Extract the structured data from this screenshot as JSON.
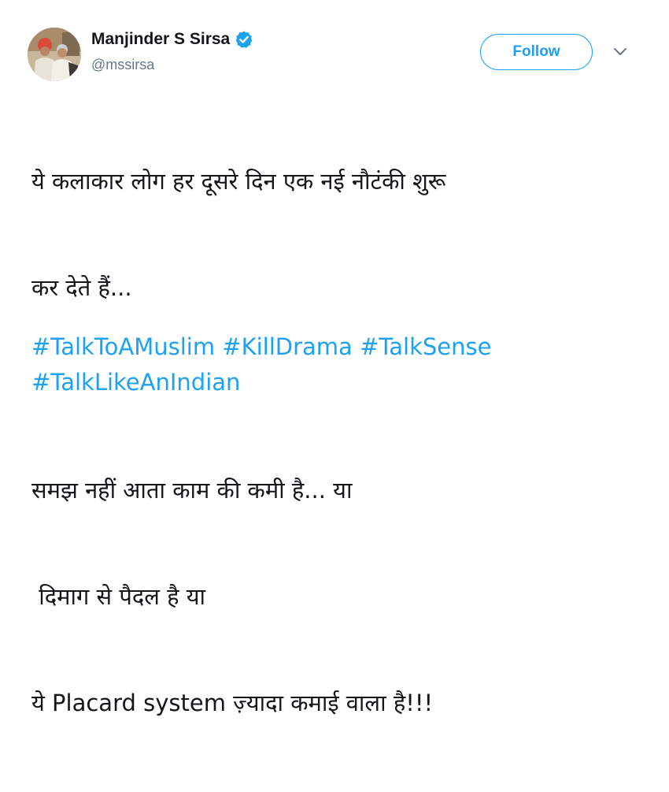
{
  "author": {
    "name": "Manjinder S Sirsa",
    "handle": "@mssirsa",
    "verified": true
  },
  "follow_button": {
    "label": "Follow"
  },
  "menu": {
    "icon": "chevron-down-icon"
  },
  "tweet": {
    "lines": [
      "ये कलाकार लोग हर दूसरे दिन एक नई नौटंकी शुरू",
      "कर देते हैं...",
      "समझ नहीं आता काम की कमी है... या",
      " दिमाग से पैदल है या",
      "ये Placard system ज़्यादा कमाई वाला है!!!"
    ],
    "hashtags": [
      "#TalkToAMuslim",
      "#KillDrama",
      "#TalkSense",
      "#TalkLikeAnIndian"
    ]
  },
  "colors": {
    "link": "#1da1f2",
    "text": "#14171a",
    "secondary": "#657786",
    "verified": "#1da1f2"
  }
}
